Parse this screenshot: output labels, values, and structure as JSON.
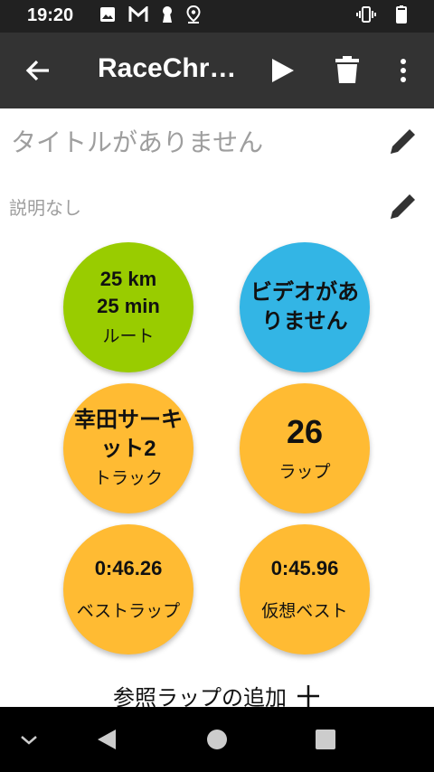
{
  "status_bar": {
    "time": "19:20",
    "icons": [
      "image-icon",
      "gmail-icon",
      "keyhole-icon",
      "location-icon"
    ],
    "right_icons": [
      "vibrate-icon",
      "battery-icon"
    ]
  },
  "app_bar": {
    "title": "RaceChrono",
    "actions": [
      "play-icon",
      "delete-icon",
      "more-vert-icon"
    ]
  },
  "session": {
    "title_placeholder": "タイトルがありません",
    "description_placeholder": "説明なし"
  },
  "tiles": [
    {
      "line1": "25 km",
      "line2": "25 min",
      "label": "ルート",
      "color": "#99cc00"
    },
    {
      "line1": "ビデオがあ",
      "line2": "りません",
      "label": "",
      "color": "#33b5e5"
    },
    {
      "line1": "幸田サーキ",
      "line2": "ット2",
      "label": "トラック",
      "color": "#ffbb33"
    },
    {
      "value": "26",
      "label": "ラップ",
      "color": "#ffbb33"
    },
    {
      "value": "0:46.26",
      "label": "ベストラップ",
      "color": "#ffbb33"
    },
    {
      "value": "0:45.96",
      "label": "仮想ベスト",
      "color": "#ffbb33"
    }
  ],
  "add_reference": {
    "label": "参照ラップの追加"
  },
  "nav_bar": [
    "hide-icon",
    "back-icon",
    "home-icon",
    "recents-icon"
  ]
}
